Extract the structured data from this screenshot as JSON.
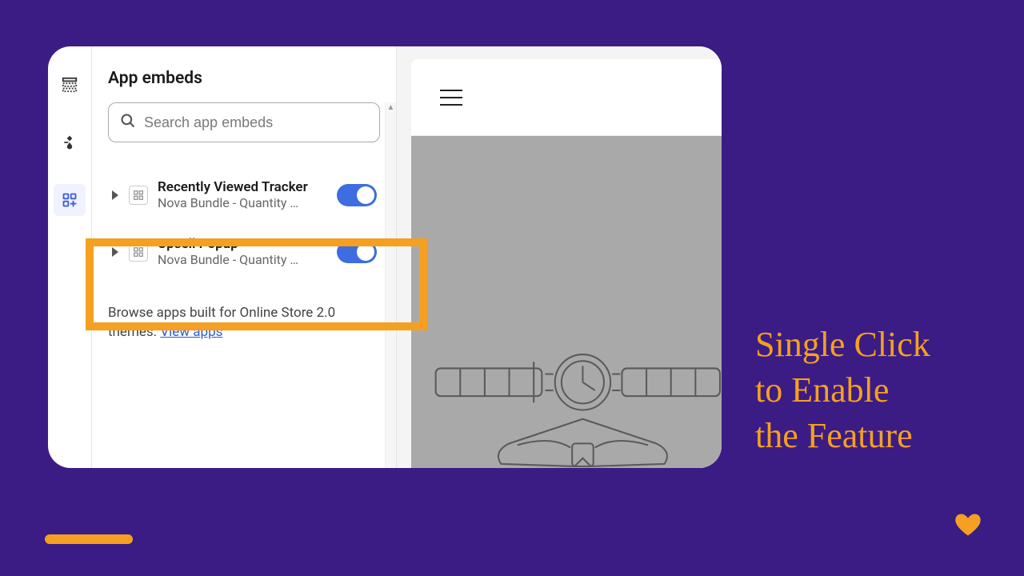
{
  "panel": {
    "title": "App embeds",
    "search_placeholder": "Search app embeds",
    "embeds": [
      {
        "title": "Recently Viewed Tracker",
        "subtitle": "Nova Bundle - Quantity …"
      },
      {
        "title": "Upsell Popup",
        "subtitle": "Nova Bundle - Quantity …"
      }
    ],
    "browse_text": "Browse apps built for Online Store 2.0 themes. ",
    "browse_link": "View apps"
  },
  "caption": {
    "line1": "Single Click",
    "line2": "to Enable",
    "line3": "the Feature"
  }
}
